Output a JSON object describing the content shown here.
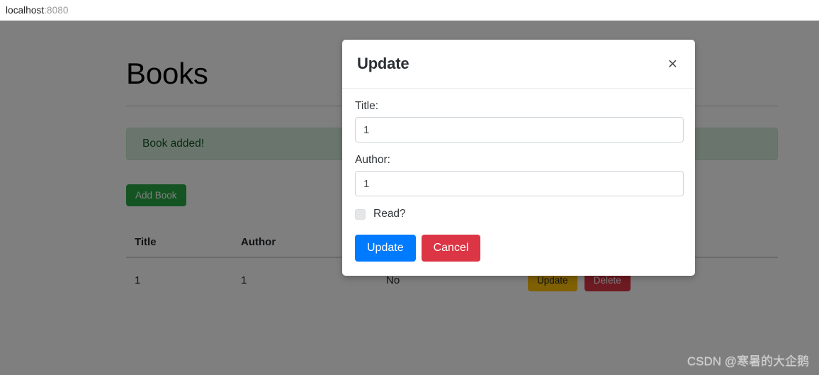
{
  "browser": {
    "url_host": "localhost",
    "url_port": ":8080"
  },
  "page": {
    "title": "Books",
    "alert_message": "Book added!",
    "add_book_label": "Add Book"
  },
  "table": {
    "headers": [
      "Title",
      "Author",
      "",
      ""
    ],
    "rows": [
      {
        "title": "1",
        "author": "1",
        "read": "No",
        "update_label": "Update",
        "delete_label": "Delete"
      }
    ]
  },
  "modal": {
    "title": "Update",
    "close_icon": "×",
    "title_label": "Title:",
    "title_value": "1",
    "author_label": "Author:",
    "author_value": "1",
    "read_label": "Read?",
    "read_checked": false,
    "update_label": "Update",
    "cancel_label": "Cancel"
  },
  "watermark": {
    "text": "CSDN @寒暑的大企鹅"
  },
  "colors": {
    "primary": "#007bff",
    "danger": "#dc3545",
    "success": "#28a745",
    "warning": "#ffc107",
    "alert_bg": "#d4edda",
    "alert_text": "#155724",
    "backdrop": "rgba(0,0,0,0.5)"
  }
}
